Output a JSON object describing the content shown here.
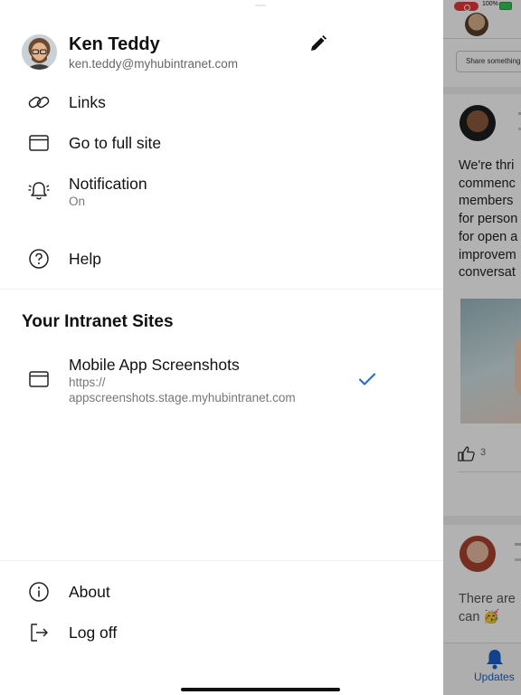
{
  "status_bar": {
    "battery": "100%"
  },
  "profile": {
    "name": "Ken Teddy",
    "email": "ken.teddy@myhubintranet.com",
    "edit_icon": "pencil-icon"
  },
  "menu": {
    "links": {
      "label": "Links",
      "icon": "link-icon"
    },
    "full_site": {
      "label": "Go to full site",
      "icon": "browser-window-icon"
    },
    "notification": {
      "label": "Notification",
      "value": "On",
      "icon": "bell-icon"
    },
    "help": {
      "label": "Help",
      "icon": "question-circle-icon"
    }
  },
  "sites": {
    "heading": "Your Intranet Sites",
    "items": [
      {
        "name": "Mobile App Screenshots",
        "url_line1": "https://",
        "url_line2": "appscreenshots.stage.myhubintranet.com",
        "selected": true,
        "icon": "browser-window-icon"
      }
    ]
  },
  "footer_menu": {
    "about": {
      "label": "About",
      "icon": "info-circle-icon"
    },
    "log_off": {
      "label": "Log off",
      "icon": "logout-icon"
    }
  },
  "background_app": {
    "share_placeholder": "Share something",
    "post_text": [
      "We're thri",
      "commenc",
      "members",
      "for person",
      "for open a",
      "improvem",
      "conversat"
    ],
    "like_count": "3",
    "post2_text": [
      "There are",
      "can 🥳"
    ],
    "tab_label": "Updates"
  },
  "colors": {
    "accent": "#2a6fd6",
    "tab_active": "#1a5fc8",
    "dim_overlay": "rgba(0,0,0,0.30)"
  }
}
